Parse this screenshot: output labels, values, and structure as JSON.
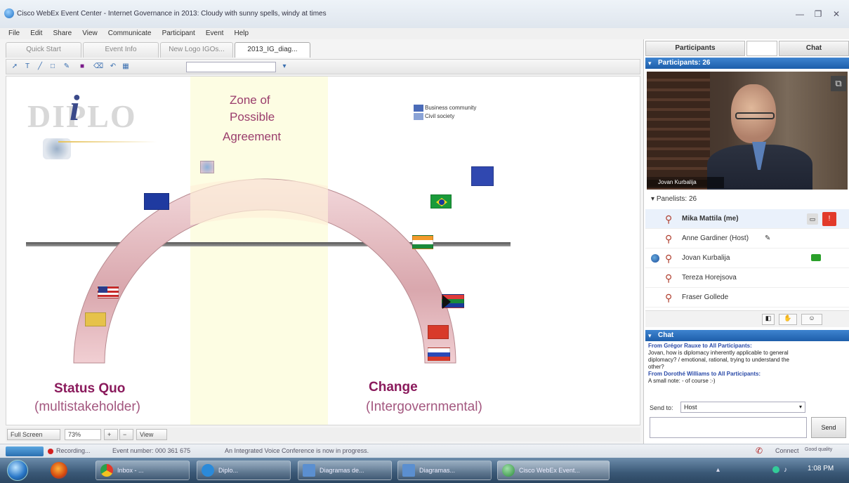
{
  "window": {
    "title": "Cisco WebEx Event Center - Internet Governance in 2013: Cloudy with sunny spells, windy at times",
    "controls": [
      "—",
      "❐",
      "✕"
    ]
  },
  "menu": [
    "File",
    "Edit",
    "Share",
    "View",
    "Communicate",
    "Participant",
    "Event",
    "Help"
  ],
  "tabs": [
    {
      "label": "Quick Start",
      "active": false
    },
    {
      "label": "Event Info",
      "active": false
    },
    {
      "label": "New Logo IGOs...",
      "active": false
    },
    {
      "label": "2013_IG_diag...",
      "active": true
    }
  ],
  "slide": {
    "logo_text": "DIPLO",
    "zopa_title_line1": "Zone of",
    "zopa_title_line2": "Possible",
    "zopa_title_line3": "Agreement",
    "legend_1": "Business community",
    "legend_2": "Civil society",
    "left_title": "Status Quo",
    "left_sub": "(multistakeholder)",
    "right_title": "Change",
    "right_sub": "(Intergovernmental)"
  },
  "bottom_controls": {
    "full_screen": "Full Screen",
    "zoom": "73%",
    "view": "View"
  },
  "status": {
    "recording": "Recording...",
    "event_number": "Event number: 000 361 675",
    "message": "An Integrated Voice Conference is now in progress.",
    "connect": "Connect",
    "quality": "Good quality"
  },
  "panel": {
    "tab_participants": "Participants",
    "tab_chat": "Chat",
    "participants_header": "Participants: 26",
    "video_name": "Jovan Kurbalija",
    "panelists_label": "Panelists: 26",
    "participants": [
      {
        "name": "Mika Mattila (me)",
        "me": true
      },
      {
        "name": "Anne Gardiner (Host)",
        "me": false
      },
      {
        "name": "Jovan Kurbalija",
        "me": false
      },
      {
        "name": "Tereza Horejsova",
        "me": false
      },
      {
        "name": "Fraser Gollede",
        "me": false
      }
    ],
    "chat_header": "Chat",
    "chat_lines": [
      "From Grégor Rauxe to All Participants:",
      "Jovan, how is diplomacy inherently applicable to general",
      "diplomacy? / emotional, rational, trying to understand the",
      "other?",
      "From Dorothé Williams to All Participants:",
      "A small note: - of course :-)"
    ],
    "send_to_label": "Send to:",
    "send_to_value": "Host",
    "send_button": "Send"
  },
  "taskbar": [
    {
      "label": "Inbox - ...",
      "color": "#e8a020"
    },
    {
      "label": "Diplo...",
      "color": "#2b8ad9"
    },
    {
      "label": "Diagramas de...",
      "color": "#5b8fd0"
    },
    {
      "label": "Diagramas...",
      "color": "#5b8fd0"
    },
    {
      "label": "Cisco WebEx Event...",
      "color": "#3aa048"
    }
  ],
  "clock": "1:08 PM"
}
